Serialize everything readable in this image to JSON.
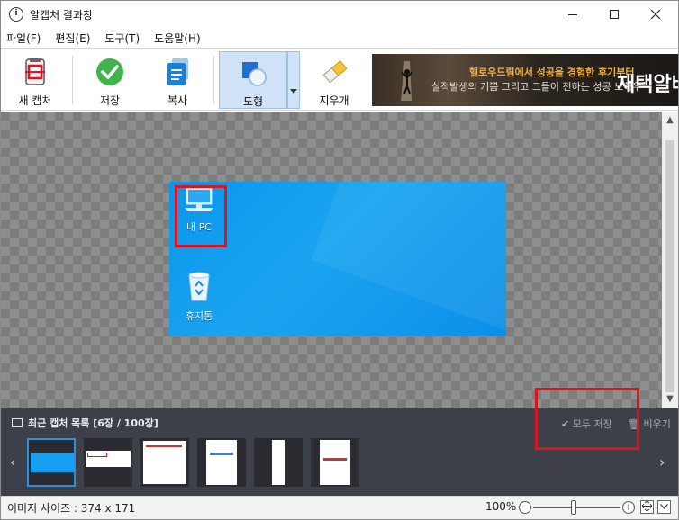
{
  "window": {
    "title": "알캡처 결과창",
    "app_icon_text": "i"
  },
  "menu": {
    "items": [
      "파일(F)",
      "편집(E)",
      "도구(T)",
      "도움말(H)"
    ]
  },
  "toolbar": {
    "new_capture": "새 캡처",
    "save": "저장",
    "copy": "복사",
    "shape": "도형",
    "eraser": "지우개"
  },
  "ad": {
    "line1": "헬로우드림에서 성공을 경험한 후기부터",
    "line2": "실적발생의 기쁨 그리고 그들이 전하는 성공 노하우",
    "big": "재택알바"
  },
  "capture": {
    "icons": [
      {
        "label": "내 PC",
        "icon": "computer-icon"
      },
      {
        "label": "휴지통",
        "icon": "recycle-bin-icon"
      }
    ],
    "accent_color": "#0a96ec",
    "highlight_color": "#e1121c"
  },
  "recent": {
    "title": "최근 캡처 목록 [6장 / 100장]",
    "save_all": "모두 저장",
    "clear": "비우기",
    "thumbnails": [
      {
        "name": "capture-1",
        "selected": true
      },
      {
        "name": "capture-2",
        "selected": false
      },
      {
        "name": "capture-3",
        "selected": false
      },
      {
        "name": "capture-4",
        "selected": false
      },
      {
        "name": "capture-5",
        "selected": false
      },
      {
        "name": "capture-6",
        "selected": false
      }
    ]
  },
  "status": {
    "image_size": "이미지 사이즈 : 374 x 171",
    "zoom": "100%"
  }
}
